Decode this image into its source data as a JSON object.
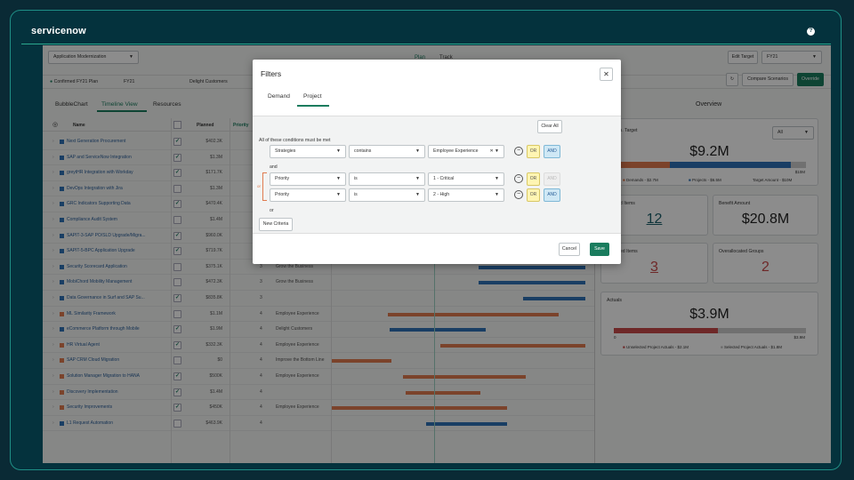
{
  "brand": {
    "logo": "servicenow",
    "help": "?"
  },
  "header": {
    "scenario_select": "Application Modernization",
    "view_tabs": [
      "Plan",
      "Track"
    ],
    "edit_target": "Edit Target",
    "fiscal_select": "FY21",
    "confirmed_plan": "Confirmed FY21 Plan",
    "filter_year": "FY21",
    "filter_strategy": "Delight Customers",
    "compare_scenarios": "Compare Scenarios",
    "override": "Override",
    "refresh_icon": "↻"
  },
  "tabs": [
    "BubbleChart",
    "Timeline View",
    "Resources"
  ],
  "grid": {
    "columns": [
      "Name",
      "Planned",
      "Priority"
    ],
    "rows": [
      {
        "name": "Next Generation Procurement",
        "checked": true,
        "amount": "$402.3K",
        "priority": "",
        "strategy": "",
        "color": "#2f72b6"
      },
      {
        "name": "SAP and ServiceNow Integration",
        "checked": true,
        "amount": "$1.3M",
        "priority": "",
        "strategy": "",
        "color": "#2f72b6"
      },
      {
        "name": "greytHR Integration with Workday",
        "checked": true,
        "amount": "$171.7K",
        "priority": "",
        "strategy": "",
        "color": "#2f72b6"
      },
      {
        "name": "DevOps Integration with Jira",
        "checked": false,
        "amount": "$1.3M",
        "priority": "",
        "strategy": "",
        "color": "#2f72b6"
      },
      {
        "name": "GRC Indicators Supporting Data",
        "checked": true,
        "amount": "$470.4K",
        "priority": "",
        "strategy": "",
        "color": "#2f72b6"
      },
      {
        "name": "Compliance Audit System",
        "checked": false,
        "amount": "$1.4M",
        "priority": "",
        "strategy": "",
        "color": "#2f72b6"
      },
      {
        "name": "SAPIT-3-SAP PO/SLD Upgrade/Migra...",
        "checked": true,
        "amount": "$960.0K",
        "priority": "",
        "strategy": "",
        "color": "#2f72b6"
      },
      {
        "name": "SAPIT-5-BPC Application Upgrade",
        "checked": true,
        "amount": "$719.7K",
        "priority": "",
        "strategy": "",
        "color": "#2f72b6"
      },
      {
        "name": "Security Scorecard Application",
        "checked": false,
        "amount": "$375.1K",
        "priority": "3",
        "strategy": "Grow the Business",
        "color": "#2f72b6"
      },
      {
        "name": "MobiChord Mobility Management",
        "checked": false,
        "amount": "$472.3K",
        "priority": "3",
        "strategy": "Grow the Business",
        "color": "#2f72b6"
      },
      {
        "name": "Data Governance in Surf and SAP Su...",
        "checked": true,
        "amount": "$835.8K",
        "priority": "3",
        "strategy": "",
        "color": "#2f72b6"
      },
      {
        "name": "ML Similarity Framework",
        "checked": false,
        "amount": "$1.1M",
        "priority": "4",
        "strategy": "Employee Experience",
        "color": "#e07b4f"
      },
      {
        "name": "eCommerce Platform through Mobile",
        "checked": true,
        "amount": "$1.9M",
        "priority": "4",
        "strategy": "Delight Customers",
        "color": "#2f72b6"
      },
      {
        "name": "HR Virtual Agent",
        "checked": true,
        "amount": "$332.3K",
        "priority": "4",
        "strategy": "Employee Experience",
        "color": "#e07b4f"
      },
      {
        "name": "SAP CRM Cloud Migration",
        "checked": false,
        "amount": "$0",
        "priority": "4",
        "strategy": "Improve the Bottom Line",
        "color": "#e07b4f"
      },
      {
        "name": "Solution Manager Migration to HANA",
        "checked": true,
        "amount": "$500K",
        "priority": "4",
        "strategy": "Employee Experience",
        "color": "#e07b4f"
      },
      {
        "name": "Discovery Implementation",
        "checked": true,
        "amount": "$1.4M",
        "priority": "4",
        "strategy": "",
        "color": "#e07b4f"
      },
      {
        "name": "Security Improvements",
        "checked": true,
        "amount": "$450K",
        "priority": "4",
        "strategy": "Employee Experience",
        "color": "#e07b4f"
      },
      {
        "name": "L1 Request Automation",
        "checked": false,
        "amount": "$463.9K",
        "priority": "4",
        "strategy": "",
        "color": "#2f72b6"
      }
    ]
  },
  "overview": {
    "title": "Overview",
    "target_label": "vs. Target",
    "all_select": "All",
    "target_value": "$9.2M",
    "target_max": "$10M",
    "legend_demands": "Demands - $2.7M",
    "legend_projects": "Projects - $6.5M",
    "legend_target": "Target Amount - $10M",
    "demands_share": 0.27,
    "projects_share": 0.65,
    "items_label": "ed Items",
    "items_value": "12",
    "benefit_label": "Benefit Amount",
    "benefit_value": "$20.8M",
    "ned_label": "ned Items",
    "ned_value": "3",
    "overalloc_label": "Overallocated Groups",
    "overalloc_value": "2",
    "actuals_label": "Actuals",
    "actuals_value": "$3.9M",
    "actuals_min": "0",
    "actuals_max": "$3.9M",
    "actuals_unselected": "Unselected Project Actuals - $2.1M",
    "actuals_selected": "Selected Project Actuals - $1.8M",
    "actuals_share": 0.54
  },
  "modal": {
    "title": "Filters",
    "close": "✕",
    "tabs": [
      "Demand",
      "Project"
    ],
    "clear_all": "Clear All",
    "all_conditions": "All of these conditions must be met",
    "and_label": "and",
    "or_label": "or",
    "or_vertical": "or",
    "new_criteria": "New Criteria",
    "conditions": [
      {
        "field": "Strategies",
        "operator": "contains",
        "value": "Employee Experience",
        "and_enabled": true
      },
      {
        "field": "Priority",
        "operator": "is",
        "value": "1 - Critical",
        "and_enabled": false
      },
      {
        "field": "Priority",
        "operator": "is",
        "value": "2 - High",
        "and_enabled": true
      }
    ],
    "or_btn": "OR",
    "and_btn": "AND",
    "cancel": "Cancel",
    "save": "Save"
  },
  "colors": {
    "brand_green": "#1a7c5e",
    "demand_orange": "#e07b4f",
    "project_blue": "#2f72b6",
    "actuals_red": "#c94a4a"
  }
}
